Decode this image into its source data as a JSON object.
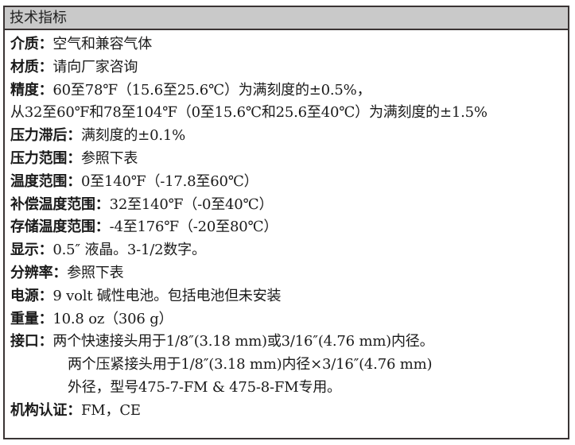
{
  "header": {
    "title": "技术指标"
  },
  "specs": [
    {
      "label": "介质：",
      "value": "空气和兼容气体"
    },
    {
      "label": "材质：",
      "value": "请向厂家咨询"
    },
    {
      "label": "精度：",
      "value": "60至78℉（15.6至25.6℃）为满刻度的±0.5%，"
    },
    {
      "label": "",
      "value": "从32至60℉和78至104℉（0至15.6℃和25.6至40℃）为满刻度的±1.5%"
    },
    {
      "label": "压力滞后：",
      "value": "满刻度的±0.1%"
    },
    {
      "label": "压力范围：",
      "value": "参照下表"
    },
    {
      "label": "温度范围：",
      "value": "0至140℉（-17.8至60℃）"
    },
    {
      "label": "补偿温度范围：",
      "value": "32至140℉（-0至40℃）"
    },
    {
      "label": "存储温度范围：",
      "value": "-4至176℉（-20至80℃）"
    },
    {
      "label": "显示：",
      "value": "0.5″ 液晶。3-1/2数字。"
    },
    {
      "label": "分辨率：",
      "value": "参照下表"
    },
    {
      "label": "电源：",
      "value": "9 volt 碱性电池。包括电池但未安装"
    },
    {
      "label": "重量：",
      "value": "10.8 oz（306 g）"
    },
    {
      "label": "接口：",
      "value": "两个快速接头用于1/8″(3.18 mm)或3/16″(4.76 mm)内径。"
    },
    {
      "label": "",
      "value": "两个压紧接头用于1/8″(3.18 mm)内径×3/16″(4.76 mm)"
    },
    {
      "label": "",
      "value": "外径，型号475-7-FM & 475-8-FM专用。"
    },
    {
      "label": "机构认证：",
      "value": "FM，CE"
    }
  ]
}
